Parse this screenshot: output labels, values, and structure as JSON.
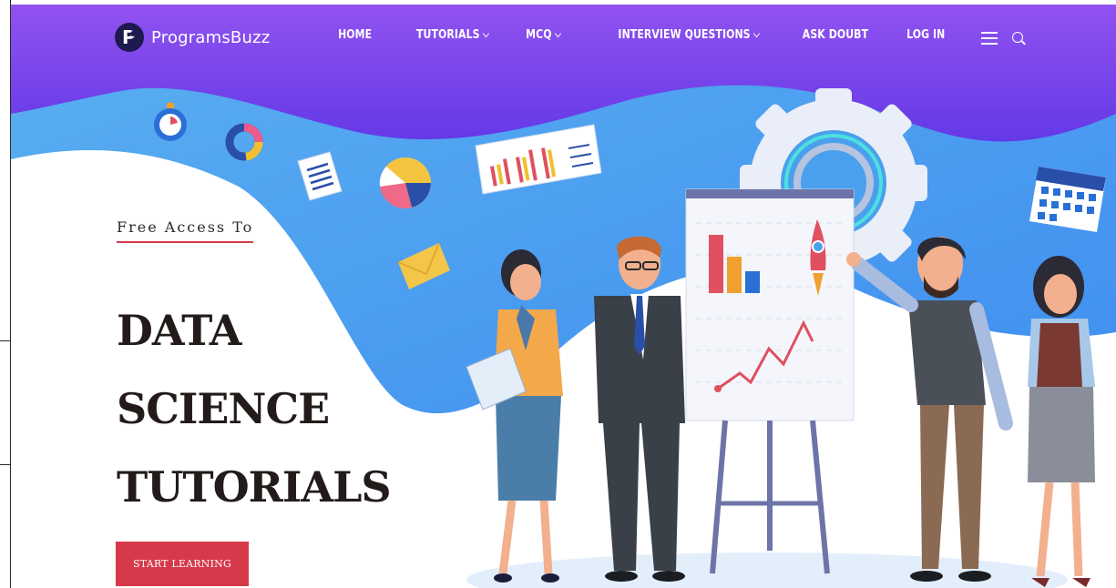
{
  "brand": {
    "name": "ProgramsBuzz"
  },
  "nav": {
    "items": [
      {
        "label": "HOME",
        "has_caret": false
      },
      {
        "label": "TUTORIALS",
        "has_caret": true
      },
      {
        "label": "MCQ",
        "has_caret": true
      },
      {
        "label": "INTERVIEW QUESTIONS",
        "has_caret": true
      },
      {
        "label": "ASK DOUBT",
        "has_caret": false
      },
      {
        "label": "LOG IN",
        "has_caret": false
      }
    ],
    "menu_icon": "hamburger-icon",
    "search_icon": "search-icon"
  },
  "hero": {
    "eyebrow": "Free Access To",
    "headline_lines": [
      "DATA",
      "SCIENCE",
      "TUTORIALS"
    ],
    "cta_label": "START LEARNING"
  },
  "colors": {
    "header_gradient_start": "#8a4cf0",
    "header_gradient_end": "#6a3be8",
    "wave_blue": "#4aa0ec",
    "accent_red": "#d63a4a",
    "heading_dark": "#231a1a"
  }
}
